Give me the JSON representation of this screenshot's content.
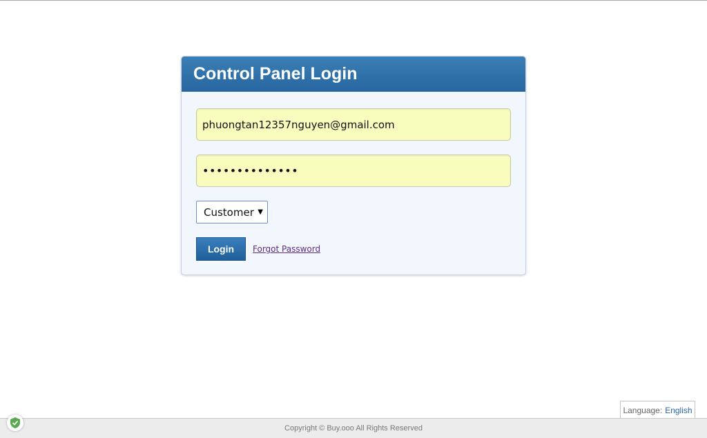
{
  "panel": {
    "title": "Control Panel Login"
  },
  "form": {
    "email_value": "phuongtan12357nguyen@gmail.com",
    "password_value": "••••••••••••••",
    "role_selected": "Customer",
    "login_label": "Login",
    "forgot_label": "Forgot Password"
  },
  "language": {
    "label": "Language:",
    "value": "English"
  },
  "footer": {
    "copyright": "Copyright © Buy.ooo All Rights Reserved"
  },
  "icons": {
    "dropdown": "chevron-down-icon",
    "shield": "shield-check-icon"
  },
  "colors": {
    "header": "#2f72ab",
    "field_bg": "#f8fdbd",
    "button": "#2a6aa8",
    "panel_bg": "#f2f6fd",
    "shield": "#5aa84f"
  }
}
